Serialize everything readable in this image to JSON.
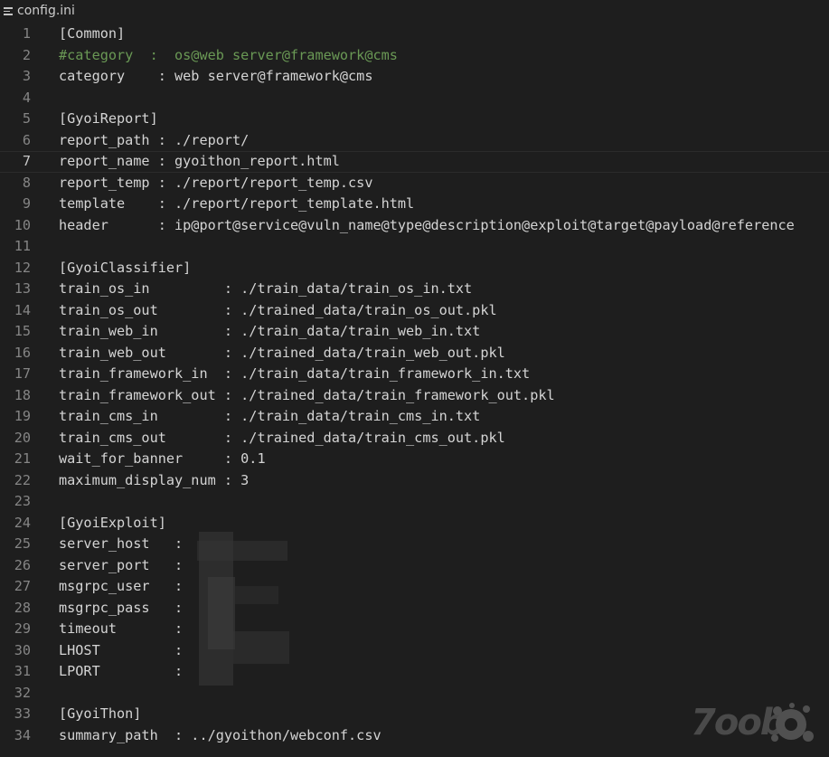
{
  "tab": {
    "icon": "lines-icon",
    "filename": "config.ini"
  },
  "current_line": 7,
  "lines": [
    {
      "n": "1",
      "t": "[Common]"
    },
    {
      "n": "2",
      "t": "#category  :  os@web server@framework@cms",
      "comment": true
    },
    {
      "n": "3",
      "t": "category    : web server@framework@cms"
    },
    {
      "n": "4",
      "t": ""
    },
    {
      "n": "5",
      "t": "[GyoiReport]"
    },
    {
      "n": "6",
      "t": "report_path : ./report/"
    },
    {
      "n": "7",
      "t": "report_name : gyoithon_report.html"
    },
    {
      "n": "8",
      "t": "report_temp : ./report/report_temp.csv"
    },
    {
      "n": "9",
      "t": "template    : ./report/report_template.html"
    },
    {
      "n": "10",
      "t": "header      : ip@port@service@vuln_name@type@description@exploit@target@payload@reference"
    },
    {
      "n": "11",
      "t": ""
    },
    {
      "n": "12",
      "t": "[GyoiClassifier]"
    },
    {
      "n": "13",
      "t": "train_os_in         : ./train_data/train_os_in.txt"
    },
    {
      "n": "14",
      "t": "train_os_out        : ./trained_data/train_os_out.pkl"
    },
    {
      "n": "15",
      "t": "train_web_in        : ./train_data/train_web_in.txt"
    },
    {
      "n": "16",
      "t": "train_web_out       : ./trained_data/train_web_out.pkl"
    },
    {
      "n": "17",
      "t": "train_framework_in  : ./train_data/train_framework_in.txt"
    },
    {
      "n": "18",
      "t": "train_framework_out : ./trained_data/train_framework_out.pkl"
    },
    {
      "n": "19",
      "t": "train_cms_in        : ./train_data/train_cms_in.txt"
    },
    {
      "n": "20",
      "t": "train_cms_out       : ./trained_data/train_cms_out.pkl"
    },
    {
      "n": "21",
      "t": "wait_for_banner     : 0.1"
    },
    {
      "n": "22",
      "t": "maximum_display_num : 3"
    },
    {
      "n": "23",
      "t": ""
    },
    {
      "n": "24",
      "t": "[GyoiExploit]"
    },
    {
      "n": "25",
      "t": "server_host   :"
    },
    {
      "n": "26",
      "t": "server_port   :"
    },
    {
      "n": "27",
      "t": "msgrpc_user   :"
    },
    {
      "n": "28",
      "t": "msgrpc_pass   :"
    },
    {
      "n": "29",
      "t": "timeout       :"
    },
    {
      "n": "30",
      "t": "LHOST         :"
    },
    {
      "n": "31",
      "t": "LPORT         :"
    },
    {
      "n": "32",
      "t": ""
    },
    {
      "n": "33",
      "t": "[GyoiThon]"
    },
    {
      "n": "34",
      "t": "summary_path  : ../gyoithon/webconf.csv"
    }
  ],
  "watermark": {
    "text": "7oob"
  },
  "colors": {
    "background": "#1e1e1e",
    "text": "#d4d4d4",
    "comment": "#6a9955",
    "line_number": "#858585"
  }
}
